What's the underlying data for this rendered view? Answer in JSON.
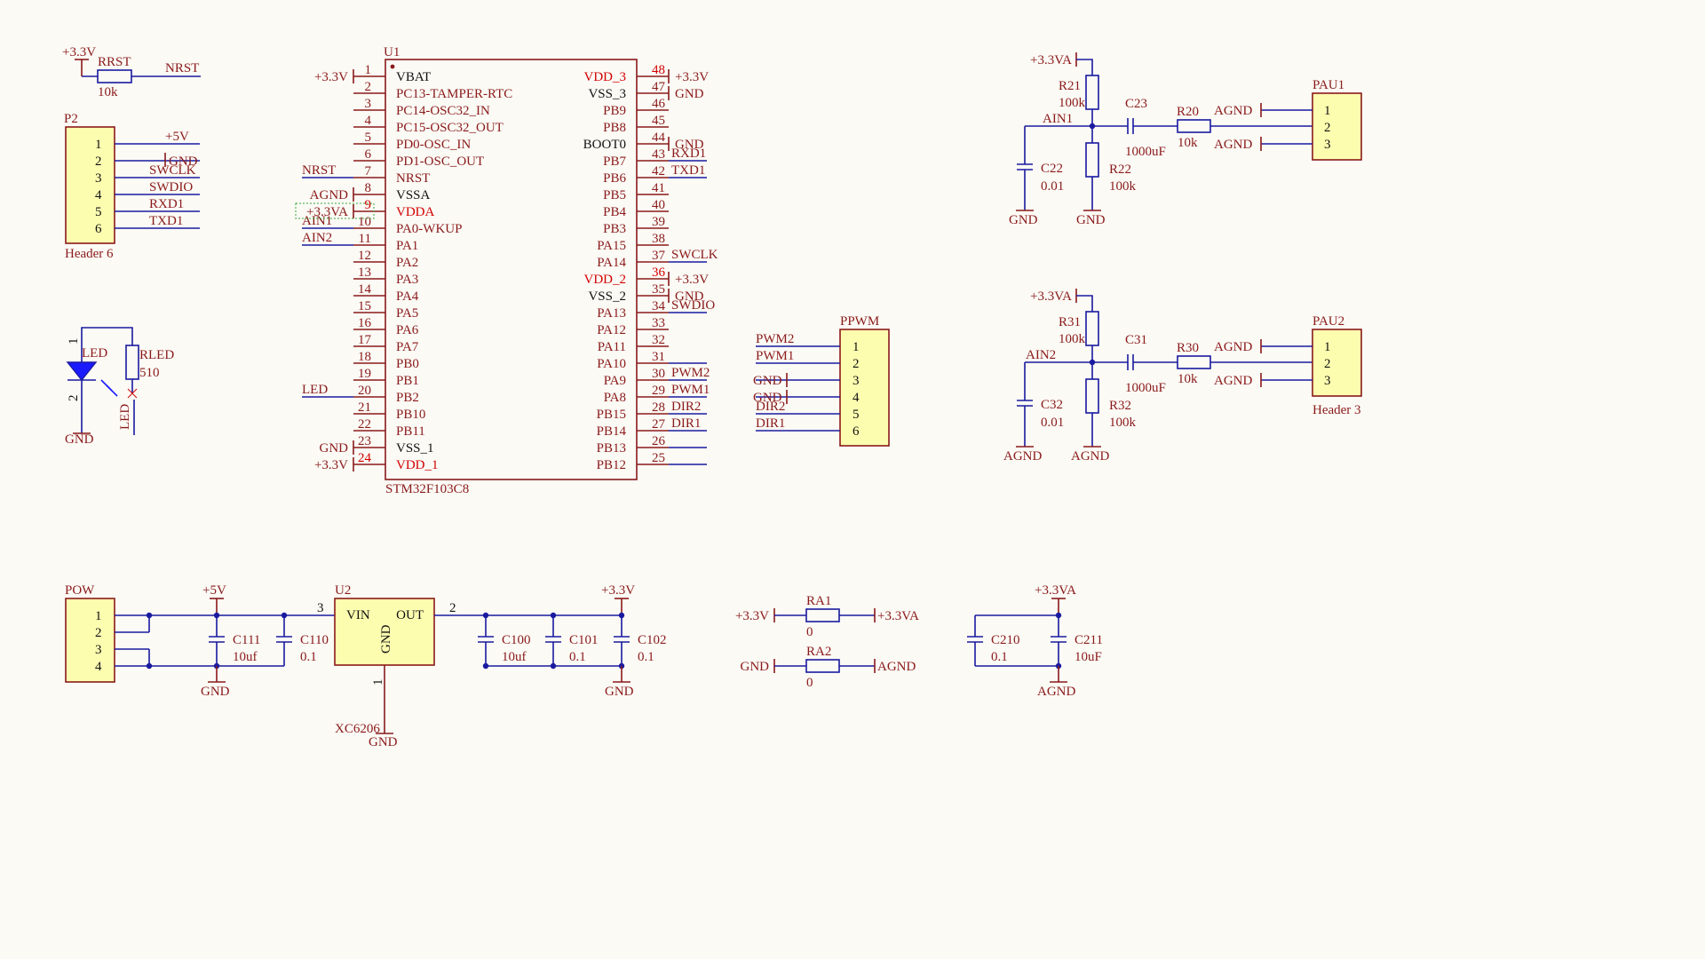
{
  "U1": {
    "designator": "U1",
    "part": "STM32F103C8",
    "left_pins": [
      {
        "num": "1",
        "name": "VBAT",
        "net": "+3.3V",
        "power": true
      },
      {
        "num": "2",
        "name": "PC13-TAMPER-RTC",
        "net": ""
      },
      {
        "num": "3",
        "name": "PC14-OSC32_IN",
        "net": ""
      },
      {
        "num": "4",
        "name": "PC15-OSC32_OUT",
        "net": ""
      },
      {
        "num": "5",
        "name": "PD0-OSC_IN",
        "net": ""
      },
      {
        "num": "6",
        "name": "PD1-OSC_OUT",
        "net": ""
      },
      {
        "num": "7",
        "name": "NRST",
        "net": "NRST"
      },
      {
        "num": "8",
        "name": "VSSA",
        "net": "AGND",
        "power": true
      },
      {
        "num": "9",
        "name": "VDDA",
        "net": "+3.3VA",
        "power": true,
        "red": true
      },
      {
        "num": "10",
        "name": "PA0-WKUP",
        "net": "AIN1"
      },
      {
        "num": "11",
        "name": "PA1",
        "net": "AIN2"
      },
      {
        "num": "12",
        "name": "PA2",
        "net": ""
      },
      {
        "num": "13",
        "name": "PA3",
        "net": ""
      },
      {
        "num": "14",
        "name": "PA4",
        "net": ""
      },
      {
        "num": "15",
        "name": "PA5",
        "net": ""
      },
      {
        "num": "16",
        "name": "PA6",
        "net": ""
      },
      {
        "num": "17",
        "name": "PA7",
        "net": ""
      },
      {
        "num": "18",
        "name": "PB0",
        "net": ""
      },
      {
        "num": "19",
        "name": "PB1",
        "net": ""
      },
      {
        "num": "20",
        "name": "PB2",
        "net": "LED"
      },
      {
        "num": "21",
        "name": "PB10",
        "net": ""
      },
      {
        "num": "22",
        "name": "PB11",
        "net": ""
      },
      {
        "num": "23",
        "name": "VSS_1",
        "net": "GND",
        "power": true
      },
      {
        "num": "24",
        "name": "VDD_1",
        "net": "+3.3V",
        "power": true,
        "red": true
      }
    ],
    "right_pins": [
      {
        "num": "48",
        "name": "VDD_3",
        "net": "+3.3V",
        "power": true,
        "red": true
      },
      {
        "num": "47",
        "name": "VSS_3",
        "net": "GND",
        "power": true
      },
      {
        "num": "46",
        "name": "PB9",
        "net": ""
      },
      {
        "num": "45",
        "name": "PB8",
        "net": ""
      },
      {
        "num": "44",
        "name": "BOOT0",
        "net": "GND",
        "power": true
      },
      {
        "num": "43",
        "name": "PB7",
        "net": "RXD1"
      },
      {
        "num": "42",
        "name": "PB6",
        "net": "TXD1"
      },
      {
        "num": "41",
        "name": "PB5",
        "net": ""
      },
      {
        "num": "40",
        "name": "PB4",
        "net": ""
      },
      {
        "num": "39",
        "name": "PB3",
        "net": ""
      },
      {
        "num": "38",
        "name": "PA15",
        "net": ""
      },
      {
        "num": "37",
        "name": "PA14",
        "net": "SWCLK"
      },
      {
        "num": "36",
        "name": "VDD_2",
        "net": "+3.3V",
        "power": true,
        "red": true
      },
      {
        "num": "35",
        "name": "VSS_2",
        "net": "GND",
        "power": true
      },
      {
        "num": "34",
        "name": "PA13",
        "net": "SWDIO"
      },
      {
        "num": "33",
        "name": "PA12",
        "net": ""
      },
      {
        "num": "32",
        "name": "PA11",
        "net": ""
      },
      {
        "num": "31",
        "name": "PA10",
        "net": ""
      },
      {
        "num": "30",
        "name": "PA9",
        "net": "PWM2"
      },
      {
        "num": "29",
        "name": "PA8",
        "net": "PWM1"
      },
      {
        "num": "28",
        "name": "PB15",
        "net": "DIR2"
      },
      {
        "num": "27",
        "name": "PB14",
        "net": "DIR1"
      },
      {
        "num": "26",
        "name": "PB13",
        "net": ""
      },
      {
        "num": "25",
        "name": "PB12",
        "net": ""
      }
    ]
  },
  "RRST": {
    "ref": "RRST",
    "value": "10k",
    "net_power": "+3.3V",
    "net": "NRST"
  },
  "P2": {
    "ref": "P2",
    "part": "Header 6",
    "pins": [
      "1",
      "2",
      "3",
      "4",
      "5",
      "6"
    ],
    "nets": [
      "+5V",
      "GND",
      "SWCLK",
      "SWDIO",
      "RXD1",
      "TXD1"
    ]
  },
  "LED_block": {
    "led_ref": "LED",
    "led_label": "LED",
    "res_ref": "RLED",
    "res_value": "510",
    "pin1": "1",
    "pin2": "2",
    "gnd": "GND"
  },
  "PPWM": {
    "ref": "PPWM",
    "pins": [
      "1",
      "2",
      "3",
      "4",
      "5",
      "6"
    ],
    "nets": [
      "PWM2",
      "PWM1",
      "GND",
      "GND",
      "DIR2",
      "DIR1"
    ]
  },
  "AIN1_block": {
    "power": "+3.3VA",
    "net": "AIN1",
    "r_top": {
      "ref": "R21",
      "value": "100k"
    },
    "r_bot": {
      "ref": "R22",
      "value": "100k"
    },
    "c_series": {
      "ref": "C23",
      "value": "1000uF"
    },
    "r_series": {
      "ref": "R20",
      "value": "10k"
    },
    "c_shunt": {
      "ref": "C22",
      "value": "0.01"
    },
    "gnd_a": "GND",
    "gnd_b": "GND",
    "header": {
      "ref": "PAU1",
      "pins": [
        "1",
        "2",
        "3"
      ],
      "nets": [
        "AGND",
        "",
        "AGND"
      ],
      "part": ""
    }
  },
  "AIN2_block": {
    "power": "+3.3VA",
    "net": "AIN2",
    "r_top": {
      "ref": "R31",
      "value": "100k"
    },
    "r_bot": {
      "ref": "R32",
      "value": "100k"
    },
    "c_series": {
      "ref": "C31",
      "value": "1000uF"
    },
    "r_series": {
      "ref": "R30",
      "value": "10k"
    },
    "c_shunt": {
      "ref": "C32",
      "value": "0.01"
    },
    "gnd_a": "AGND",
    "gnd_b": "AGND",
    "header": {
      "ref": "PAU2",
      "pins": [
        "1",
        "2",
        "3"
      ],
      "nets": [
        "AGND",
        "",
        "AGND"
      ],
      "part": "Header 3"
    }
  },
  "POW": {
    "ref": "POW",
    "pins": [
      "1",
      "2",
      "3",
      "4"
    ]
  },
  "input_caps": {
    "power": "+5V",
    "gnd": "GND",
    "caps": [
      {
        "ref": "C111",
        "value": "10uf"
      },
      {
        "ref": "C110",
        "value": "0.1"
      }
    ]
  },
  "U2": {
    "ref": "U2",
    "part": "XC6206",
    "vin": "VIN",
    "out": "OUT",
    "gnd": "GND",
    "pin_vin": "3",
    "pin_out": "2",
    "pin_gnd": "1",
    "gnd_net": "GND"
  },
  "output_caps": {
    "power": "+3.3V",
    "gnd": "GND",
    "caps": [
      {
        "ref": "C100",
        "value": "10uf"
      },
      {
        "ref": "C101",
        "value": "0.1"
      },
      {
        "ref": "C102",
        "value": "0.1"
      }
    ]
  },
  "RA1": {
    "ref": "RA1",
    "value": "0",
    "left": "+3.3V",
    "right": "+3.3VA"
  },
  "RA2": {
    "ref": "RA2",
    "value": "0",
    "left": "GND",
    "right": "AGND"
  },
  "analog_caps": {
    "power": "+3.3VA",
    "gnd": "AGND",
    "caps": [
      {
        "ref": "C210",
        "value": "0.1"
      },
      {
        "ref": "C211",
        "value": "10uF"
      }
    ]
  },
  "colors": {
    "wire": "#1a1aa0",
    "component": "#8a1a1a",
    "body_fill": "#fdfdb0",
    "red_pin": "#d20000",
    "background": "#fbfaf5"
  }
}
